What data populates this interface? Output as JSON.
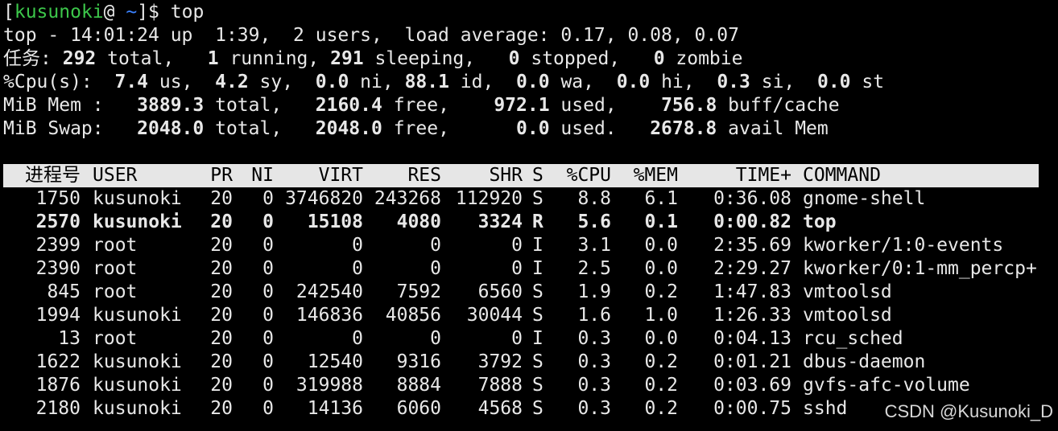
{
  "prompt": {
    "open_bracket": "[",
    "user": "kusunoki",
    "at": "@ ",
    "path": "~",
    "close_and_dollar": "]$ ",
    "command": "top"
  },
  "summary": {
    "uptime_line": "top - 14:01:24 up  1:39,  2 users,  load average: 0.17, 0.08, 0.07",
    "tasks": {
      "label": "任务:",
      "total": "292",
      "total_label": " total,   ",
      "running": "1",
      "running_label": " running, ",
      "sleeping": "291",
      "sleeping_label": " sleeping,   ",
      "stopped": "0",
      "stopped_label": " stopped,   ",
      "zombie": "0",
      "zombie_label": " zombie"
    },
    "cpu": {
      "label": "%Cpu(s):  ",
      "us": "7.4",
      "us_label": " us,  ",
      "sy": "4.2",
      "sy_label": " sy,  ",
      "ni": "0.0",
      "ni_label": " ni, ",
      "id": "88.1",
      "id_label": " id,  ",
      "wa": "0.0",
      "wa_label": " wa,  ",
      "hi": "0.0",
      "hi_label": " hi,  ",
      "si": "0.3",
      "si_label": " si,  ",
      "st": "0.0",
      "st_label": " st"
    },
    "mem": {
      "label": "MiB Mem :   ",
      "total": "3889.3",
      "total_label": " total,   ",
      "free": "2160.4",
      "free_label": " free,    ",
      "used": "972.1",
      "used_label": " used,    ",
      "buff": "756.8",
      "buff_label": " buff/cache"
    },
    "swap": {
      "label": "MiB Swap:   ",
      "total": "2048.0",
      "total_label": " total,   ",
      "free": "2048.0",
      "free_label": " free,      ",
      "used": "0.0",
      "used_label": " used.   ",
      "avail": "2678.8",
      "avail_label": " avail Mem"
    }
  },
  "columns": {
    "pid": "进程号",
    "user": "USER",
    "pr": "PR",
    "ni": "NI",
    "virt": "VIRT",
    "res": "RES",
    "shr": "SHR",
    "s": "S",
    "cpu": "%CPU",
    "mem": "%MEM",
    "time": "TIME+",
    "command": "COMMAND"
  },
  "processes": [
    {
      "pid": "1750",
      "user": "kusunoki",
      "pr": "20",
      "ni": "0",
      "virt": "3746820",
      "res": "243268",
      "shr": "112920",
      "s": "S",
      "cpu": "8.8",
      "mem": "6.1",
      "time": "0:36.08",
      "command": "gnome-shell"
    },
    {
      "pid": "2570",
      "user": "kusunoki",
      "pr": "20",
      "ni": "0",
      "virt": "15108",
      "res": "4080",
      "shr": "3324",
      "s": "R",
      "cpu": "5.6",
      "mem": "0.1",
      "time": "0:00.82",
      "command": "top"
    },
    {
      "pid": "2399",
      "user": "root",
      "pr": "20",
      "ni": "0",
      "virt": "0",
      "res": "0",
      "shr": "0",
      "s": "I",
      "cpu": "3.1",
      "mem": "0.0",
      "time": "2:35.69",
      "command": "kworker/1:0-events"
    },
    {
      "pid": "2390",
      "user": "root",
      "pr": "20",
      "ni": "0",
      "virt": "0",
      "res": "0",
      "shr": "0",
      "s": "I",
      "cpu": "2.5",
      "mem": "0.0",
      "time": "2:29.27",
      "command": "kworker/0:1-mm_percp+"
    },
    {
      "pid": "845",
      "user": "root",
      "pr": "20",
      "ni": "0",
      "virt": "242540",
      "res": "7592",
      "shr": "6560",
      "s": "S",
      "cpu": "1.9",
      "mem": "0.2",
      "time": "1:47.83",
      "command": "vmtoolsd"
    },
    {
      "pid": "1994",
      "user": "kusunoki",
      "pr": "20",
      "ni": "0",
      "virt": "146836",
      "res": "40856",
      "shr": "30044",
      "s": "S",
      "cpu": "1.6",
      "mem": "1.0",
      "time": "1:26.33",
      "command": "vmtoolsd"
    },
    {
      "pid": "13",
      "user": "root",
      "pr": "20",
      "ni": "0",
      "virt": "0",
      "res": "0",
      "shr": "0",
      "s": "I",
      "cpu": "0.3",
      "mem": "0.0",
      "time": "0:04.13",
      "command": "rcu_sched"
    },
    {
      "pid": "1622",
      "user": "kusunoki",
      "pr": "20",
      "ni": "0",
      "virt": "12540",
      "res": "9316",
      "shr": "3792",
      "s": "S",
      "cpu": "0.3",
      "mem": "0.2",
      "time": "0:01.21",
      "command": "dbus-daemon"
    },
    {
      "pid": "1876",
      "user": "kusunoki",
      "pr": "20",
      "ni": "0",
      "virt": "319988",
      "res": "8884",
      "shr": "7888",
      "s": "S",
      "cpu": "0.3",
      "mem": "0.2",
      "time": "0:03.69",
      "command": "gvfs-afc-volume"
    },
    {
      "pid": "2180",
      "user": "kusunoki",
      "pr": "20",
      "ni": "0",
      "virt": "14136",
      "res": "6060",
      "shr": "4568",
      "s": "S",
      "cpu": "0.3",
      "mem": "0.2",
      "time": "0:00.75",
      "command": "sshd"
    }
  ],
  "watermark": "CSDN @Kusunoki_D",
  "colors": {
    "background": "#000000",
    "text": "#e8e8e8",
    "prompt_user": "#3cc64a",
    "prompt_path": "#3b82ff",
    "header_bg": "#e6e6e6"
  }
}
